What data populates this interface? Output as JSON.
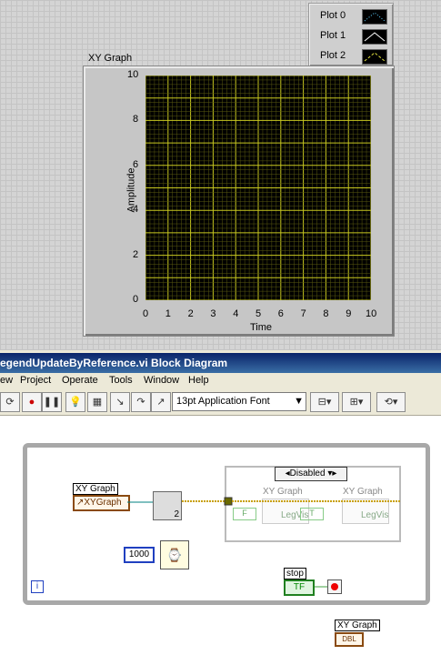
{
  "front_panel": {
    "legend": {
      "items": [
        {
          "label": "Plot 0",
          "color": "#60d0ff",
          "style": "dotted-triangle"
        },
        {
          "label": "Plot 1",
          "color": "#ffffff",
          "style": "solid-triangle"
        },
        {
          "label": "Plot 2",
          "color": "#e0e040",
          "style": "dashed-triangle"
        }
      ]
    },
    "graph_label": "XY Graph",
    "y_axis_label": "Amplitude",
    "x_axis_label": "Time",
    "grid_color": "#c8c820",
    "plot_bg": "#000000"
  },
  "chart_data": {
    "type": "line",
    "xlabel": "Time",
    "ylabel": "Amplitude",
    "xlim": [
      0,
      10
    ],
    "ylim": [
      0,
      10
    ],
    "x_ticks": [
      "0",
      "1",
      "2",
      "3",
      "4",
      "5",
      "6",
      "7",
      "8",
      "9",
      "10"
    ],
    "y_ticks": [
      "0",
      "2",
      "4",
      "6",
      "8",
      "10"
    ],
    "grid": true,
    "series": []
  },
  "window": {
    "title": "egendUpdateByReference.vi Block Diagram"
  },
  "menu": [
    "ew",
    "Project",
    "Operate",
    "Tools",
    "Window",
    "Help"
  ],
  "toolbar": {
    "font_selector": "13pt Application Font",
    "icons": [
      "run-continuously-icon",
      "abort-icon",
      "pause-icon",
      "highlight-icon",
      "retain-wire-icon",
      "step-into-icon",
      "step-over-icon",
      "step-out-icon",
      "align-icon",
      "distribute-icon",
      "reorder-icon"
    ]
  },
  "diagram": {
    "ref_label": "XY Graph",
    "ref_terminal": "XYGraph",
    "case_selector": "Disabled",
    "prop1_label": "XY Graph",
    "prop1_value": "LegVis",
    "prop2_label": "XY Graph",
    "prop2_value": "LegVis",
    "bool_const": "F",
    "bool_const2": "T",
    "wait_value": "1000",
    "index_num": "2",
    "stop_label": "stop",
    "stop_terminal": "TF",
    "iteration_label": "i",
    "bottom_label": "XY Graph",
    "bottom_terminal": "DBL"
  }
}
